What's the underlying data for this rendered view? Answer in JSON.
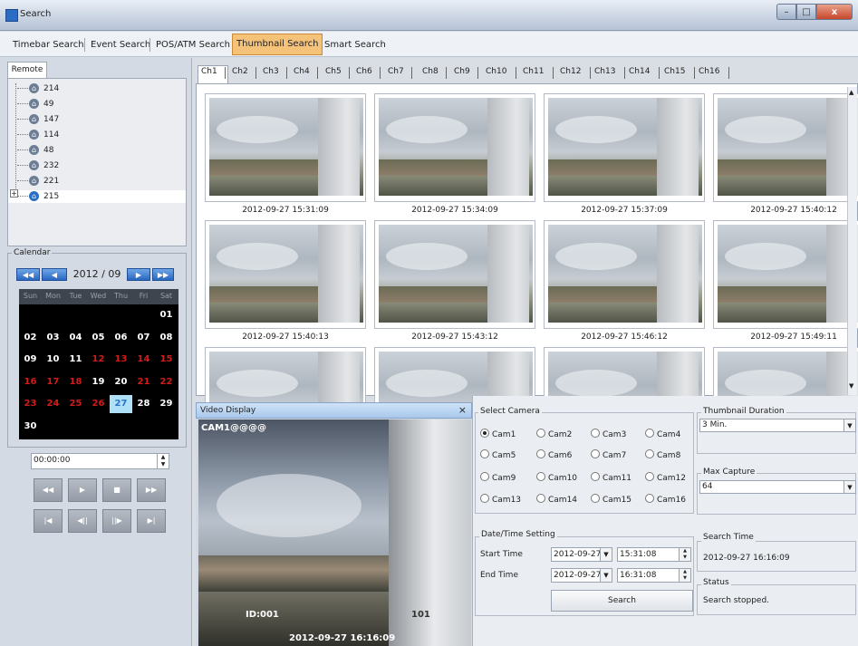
{
  "window": {
    "title": "Search",
    "min_glyph": "–",
    "max_glyph": "□",
    "close_glyph": "x"
  },
  "top_tabs": [
    {
      "label": "Timebar Search"
    },
    {
      "label": "Event Search"
    },
    {
      "label": "POS/ATM Search"
    },
    {
      "label": "Thumbnail Search",
      "active": true
    },
    {
      "label": "Smart Search"
    }
  ],
  "remote": {
    "tab_label": "Remote",
    "tree": [
      "214",
      "49",
      "147",
      "114",
      "48",
      "232",
      "221",
      "215"
    ],
    "selected": "215",
    "house_glyph": "⌂",
    "expand_glyph": "+"
  },
  "calendar": {
    "legend": "Calendar",
    "month_label": "2012 / 09",
    "prev_year": "◀◀",
    "prev_month": "◀",
    "next_month": "▶",
    "next_year": "▶▶",
    "day_headers": [
      "Sun",
      "Mon",
      "Tue",
      "Wed",
      "Thu",
      "Fri",
      "Sat"
    ],
    "rows": [
      [
        "",
        "",
        "",
        "",
        "",
        "",
        "01"
      ],
      [
        "02",
        "03",
        "04",
        "05",
        "06",
        "07",
        "08"
      ],
      [
        "09",
        "10",
        "11",
        "12",
        "13",
        "14",
        "15"
      ],
      [
        "16",
        "17",
        "18",
        "19",
        "20",
        "21",
        "22"
      ],
      [
        "23",
        "24",
        "25",
        "26",
        "27",
        "28",
        "29"
      ],
      [
        "30",
        "",
        "",
        "",
        "",
        "",
        ""
      ]
    ],
    "red_days": [
      "12",
      "13",
      "14",
      "15",
      "16",
      "17",
      "18",
      "21",
      "22",
      "23",
      "24",
      "25",
      "26"
    ],
    "selected_day": "27"
  },
  "playback": {
    "time_value": "00:00:00",
    "spin_up": "▲",
    "spin_down": "▼",
    "row1": [
      "◀◀",
      "▶",
      "■",
      "▶▶"
    ],
    "row2": [
      "|◀",
      "◀||",
      "||▶",
      "▶|"
    ]
  },
  "channel_tabs": [
    "Ch1",
    "Ch2",
    "Ch3",
    "Ch4",
    "Ch5",
    "Ch6",
    "Ch7",
    "Ch8",
    "Ch9",
    "Ch10",
    "Ch11",
    "Ch12",
    "Ch13",
    "Ch14",
    "Ch15",
    "Ch16"
  ],
  "thumbnails": [
    "2012-09-27 15:31:09",
    "2012-09-27 15:34:09",
    "2012-09-27 15:37:09",
    "2012-09-27 15:40:12",
    "2012-09-27 15:40:13",
    "2012-09-27 15:43:12",
    "2012-09-27 15:46:12",
    "2012-09-27 15:49:11",
    "",
    "",
    "",
    ""
  ],
  "video_display": {
    "title": "Video Display",
    "close_glyph": "×",
    "camera_overlay": "CAM1@@@@",
    "id_overlay": "ID:001",
    "num_overlay": "101",
    "timestamp": "2012-09-27 16:16:09"
  },
  "select_camera": {
    "legend": "Select Camera",
    "cameras": [
      "Cam1",
      "Cam2",
      "Cam3",
      "Cam4",
      "Cam5",
      "Cam6",
      "Cam7",
      "Cam8",
      "Cam9",
      "Cam10",
      "Cam11",
      "Cam12",
      "Cam13",
      "Cam14",
      "Cam15",
      "Cam16"
    ],
    "selected": "Cam1"
  },
  "thumbnail_duration": {
    "legend": "Thumbnail Duration",
    "value": "3 Min."
  },
  "max_capture": {
    "legend": "Max Capture",
    "value": "64"
  },
  "datetime": {
    "legend": "Date/Time Setting",
    "start_label": "Start Time",
    "start_date": "2012-09-27",
    "start_time": "15:31:08",
    "end_label": "End Time",
    "end_date": "2012-09-27",
    "end_time": "16:31:08",
    "search_label": "Search"
  },
  "search_time": {
    "legend": "Search Time",
    "value": "2012-09-27 16:16:09"
  },
  "status": {
    "legend": "Status",
    "value": "Search stopped."
  }
}
